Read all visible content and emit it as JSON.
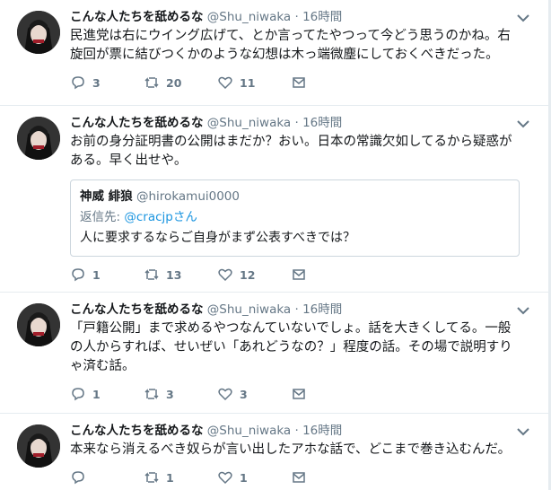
{
  "tweets": [
    {
      "name": "こんな人たちを舐めるな",
      "handle": "@Shu_niwaka",
      "dot": "·",
      "time": "16時間",
      "text": "民進党は右にウイング広げて、とか言ってたやつって今どう思うのかね。右旋回が票に結びつくかのような幻想は木っ端微塵にしておくべきだった。",
      "replies": "3",
      "retweets": "20",
      "likes": "11"
    },
    {
      "name": "こんな人たちを舐めるな",
      "handle": "@Shu_niwaka",
      "dot": "·",
      "time": "16時間",
      "text": "お前の身分証明書の公開はまだか？おい。日本の常識欠如してるから疑惑がある。早く出せや。",
      "quote": {
        "name": "神威 緋狼",
        "handle": "@hirokamui0000",
        "reply_prefix": "返信先: ",
        "reply_mention": "@cracjpさん",
        "text": "人に要求するならご自身がまず公表すべきでは？"
      },
      "replies": "1",
      "retweets": "13",
      "likes": "12"
    },
    {
      "name": "こんな人たちを舐めるな",
      "handle": "@Shu_niwaka",
      "dot": "·",
      "time": "16時間",
      "text": "「戸籍公開」まで求めるやつなんていないでしょ。話を大きくしてる。一般の人からすれば、せいぜい「あれどうなの？」程度の話。その場で説明すりゃ済む話。",
      "replies": "1",
      "retweets": "3",
      "likes": "3"
    },
    {
      "name": "こんな人たちを舐めるな",
      "handle": "@Shu_niwaka",
      "dot": "·",
      "time": "16時間",
      "text": "本来なら消えるべき奴らが言い出したアホな話で、どこまで巻き込むんだ。",
      "replies": "",
      "retweets": "1",
      "likes": "1"
    }
  ],
  "icons": {
    "reply": "reply-icon",
    "retweet": "retweet-icon",
    "like": "heart-icon",
    "dm": "mail-icon",
    "menu": "chevron-down-icon"
  }
}
